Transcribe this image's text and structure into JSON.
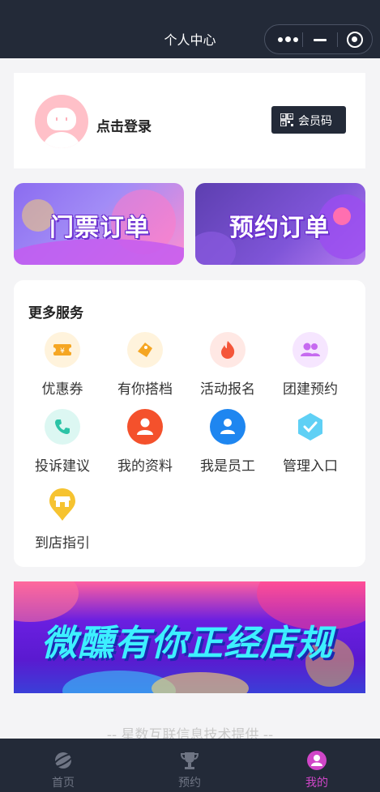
{
  "nav": {
    "title": "个人中心"
  },
  "profile": {
    "login_label": "点击登录",
    "member_code_label": "会员码"
  },
  "orders": [
    {
      "label": "门票订单"
    },
    {
      "label": "预约订单"
    }
  ],
  "services": {
    "title": "更多服务",
    "items": [
      {
        "label": "优惠券",
        "icon": "coupon-icon"
      },
      {
        "label": "有你搭档",
        "icon": "tag-icon"
      },
      {
        "label": "活动报名",
        "icon": "flame-icon"
      },
      {
        "label": "团建预约",
        "icon": "group-icon"
      },
      {
        "label": "投诉建议",
        "icon": "phone-icon"
      },
      {
        "label": "我的资料",
        "icon": "user-icon"
      },
      {
        "label": "我是员工",
        "icon": "staff-icon"
      },
      {
        "label": "管理入口",
        "icon": "check-hexagon-icon"
      },
      {
        "label": "到店指引",
        "icon": "store-pin-icon"
      }
    ]
  },
  "banner": {
    "text": "微醺有你正经店规"
  },
  "footer": {
    "text": "-- 星数互联信息技术提供 --"
  },
  "tabbar": {
    "items": [
      {
        "label": "首页",
        "icon": "planet-icon",
        "active": false
      },
      {
        "label": "预约",
        "icon": "trophy-icon",
        "active": false
      },
      {
        "label": "我的",
        "icon": "profile-icon",
        "active": true
      }
    ]
  },
  "colors": {
    "nav_bg": "#232a38",
    "tab_active": "#d046c8",
    "accent_dark": "#232a38"
  }
}
